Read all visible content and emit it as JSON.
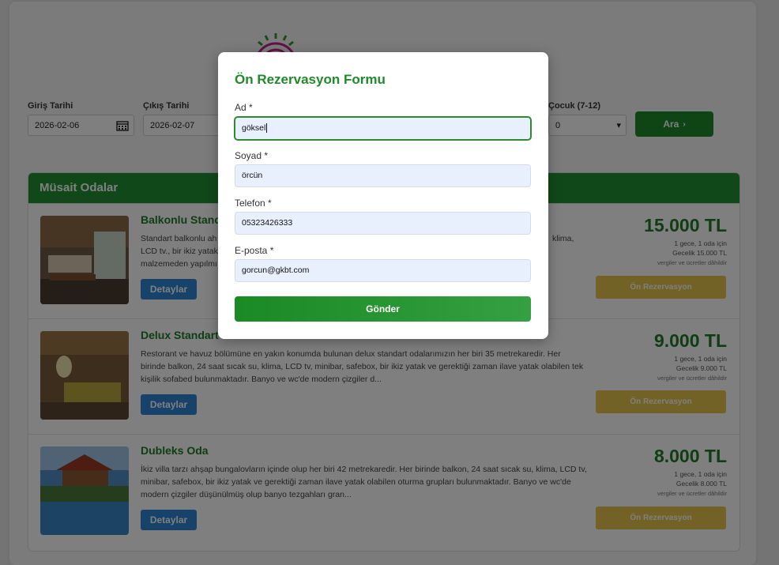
{
  "search": {
    "checkin_label": "Giriş Tarihi",
    "checkin_value": "2026-02-06",
    "checkout_label": "Çıkış Tarihi",
    "checkout_value": "2026-02-07",
    "child_label": "Çocuk (7-12)",
    "child_value": "0",
    "search_button": "Ara",
    "search_button_arrow": "›"
  },
  "rooms_panel": {
    "title": "Müsait Odalar",
    "rooms": [
      {
        "name": "Balkonlu Stand",
        "desc_left": "Standart balkonlu ah",
        "desc_line2": "LCD tv., bir ikiz yatak",
        "desc_line3": "malzemeden yapılmı",
        "desc_right": "klima,",
        "details": "Detaylar",
        "price": "15.000 TL",
        "nights": "1 gece, 1 oda için",
        "nightly": "Gecelik 15.000 TL",
        "tax": "vergiler ve ücretler dâhildir",
        "reserve": "Ön Rezervasyon"
      },
      {
        "name": "Delux Standart",
        "desc": "Restorant ve havuz bölümüne en yakın konumda bulunan delux standart odalarımızın her biri 35 metrekaredir. Her birinde balkon, 24 saat sıcak su, klima, LCD tv, minibar, safebox, bir ikiz yatak ve gerektiği zaman ilave yatak olabilen tek kişilik sofabed bulunmaktadır. Banyo ve wc'de modern çizgiler d...",
        "details": "Detaylar",
        "price": "9.000 TL",
        "nights": "1 gece, 1 oda için",
        "nightly": "Gecelik 9.000 TL",
        "tax": "vergiler ve ücretler dâhildir",
        "reserve": "Ön Rezervasyon"
      },
      {
        "name": "Dubleks Oda",
        "desc": "İkiz villa tarzı ahşap bungalovların içinde olup her biri 42 metrekaredir. Her birinde balkon, 24 saat sıcak su, klima, LCD tv, minibar, safebox, bir ikiz yatak ve gerektiği zaman ilave yatak olabilen oturma grupları bulunmaktadır. Banyo ve wc'de modern çizgiler düşünülmüş olup banyo tezgahları gran...",
        "details": "Detaylar",
        "price": "8.000 TL",
        "nights": "1 gece, 1 oda için",
        "nightly": "Gecelik 8.000 TL",
        "tax": "vergiler ve ücretler dâhildir",
        "reserve": "Ön Rezervasyon"
      }
    ]
  },
  "modal": {
    "title": "Ön Rezervasyon Formu",
    "first_name_label": "Ad *",
    "first_name_value": "göksel",
    "last_name_label": "Soyad *",
    "last_name_value": "örcün",
    "phone_label": "Telefon *",
    "phone_value": "05323426333",
    "email_label": "E-posta *",
    "email_value": "gorcun@gkbt.com",
    "submit": "Gönder"
  },
  "colors": {
    "brand_green": "#229134",
    "reserve_yellow": "#e6c44a",
    "details_blue": "#2f86d6"
  }
}
